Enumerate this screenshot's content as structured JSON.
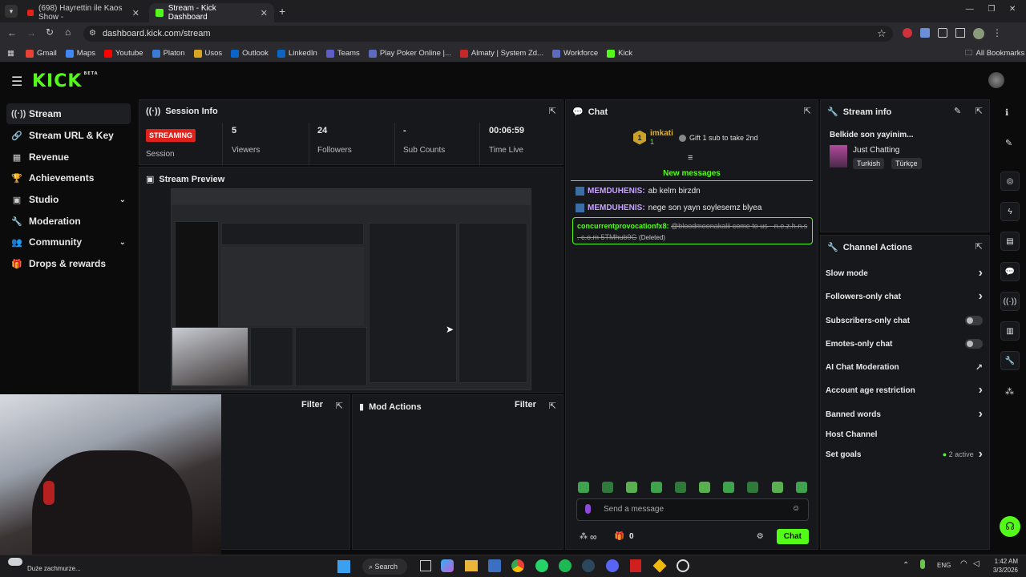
{
  "browser": {
    "tabs": [
      {
        "title": "(698) Hayrettin ile Kaos Show -",
        "close": "✕"
      },
      {
        "title": "Stream - Kick Dashboard",
        "close": "✕"
      }
    ],
    "new_tab": "+",
    "url": "dashboard.kick.com/stream",
    "bookmarks": [
      "Gmail",
      "Maps",
      "Youtube",
      "Platon",
      "Usos",
      "Outlook",
      "LinkedIn",
      "Teams",
      "Play Poker Online |...",
      "Almaty | System Zd...",
      "Workforce",
      "Kick"
    ],
    "all_bookmarks": "All Bookmarks"
  },
  "app": {
    "logo": "KICK",
    "logo_badge": "BETA"
  },
  "sidebar": {
    "items": [
      {
        "label": "Stream",
        "icon": "broadcast-icon",
        "glyph": "((·))"
      },
      {
        "label": "Stream URL & Key",
        "icon": "link-icon",
        "glyph": "🔗"
      },
      {
        "label": "Revenue",
        "icon": "revenue-icon",
        "glyph": "▦"
      },
      {
        "label": "Achievements",
        "icon": "trophy-icon",
        "glyph": "🏆"
      },
      {
        "label": "Studio",
        "icon": "studio-icon",
        "glyph": "▣"
      },
      {
        "label": "Moderation",
        "icon": "wrench-icon",
        "glyph": "🔧"
      },
      {
        "label": "Community",
        "icon": "users-icon",
        "glyph": "👥"
      },
      {
        "label": "Drops & rewards",
        "icon": "gift-icon",
        "glyph": "🎁"
      }
    ]
  },
  "session": {
    "title": "Session Info",
    "status_badge": "STREAMING",
    "stats": [
      {
        "value": "",
        "label": "Session"
      },
      {
        "value": "5",
        "label": "Viewers"
      },
      {
        "value": "24",
        "label": "Followers"
      },
      {
        "value": "-",
        "label": "Sub Counts"
      },
      {
        "value": "00:06:59",
        "label": "Time Live"
      }
    ]
  },
  "preview": {
    "title": "Stream Preview"
  },
  "panels": {
    "filter_label": "Filter",
    "mod_actions_title": "Mod Actions"
  },
  "chat": {
    "title": "Chat",
    "top_user": "imkati",
    "top_user_count": "1",
    "gift_text": "Gift 1 sub to take 2nd",
    "new_messages": "New messages",
    "messages": [
      {
        "user": "MEMDUHENIS:",
        "text": "ab kelm birzdn",
        "color": "#c8a3ff"
      },
      {
        "user": "MEMDUHENIS:",
        "text": "nege son yayn soylesemz blyea",
        "color": "#c8a3ff"
      }
    ],
    "deleted_msg": {
      "user": "concurrentprovocationfx8:",
      "text": "@bloodmoonakalii come to us - n.e.z.h.n.s . c.o.m 5TMhub9G",
      "deleted_tag": "(Deleted)"
    },
    "input_placeholder": "Send a message",
    "infinity": "∞",
    "gift_count": "0",
    "send_button": "Chat"
  },
  "stream_info": {
    "title": "Stream info",
    "stream_title": "Belkide son yayinim...",
    "category": "Just Chatting",
    "tags": [
      "Turkish",
      "Türkçe"
    ]
  },
  "channel_actions": {
    "title": "Channel Actions",
    "items": [
      {
        "label": "Slow mode",
        "control": "chevron"
      },
      {
        "label": "Followers-only chat",
        "control": "chevron"
      },
      {
        "label": "Subscribers-only chat",
        "control": "toggle"
      },
      {
        "label": "Emotes-only chat",
        "control": "toggle"
      },
      {
        "label": "AI Chat Moderation",
        "control": "external"
      },
      {
        "label": "Account age restriction",
        "control": "chevron"
      },
      {
        "label": "Banned words",
        "control": "chevron"
      },
      {
        "label": "Host Channel",
        "control": "none"
      },
      {
        "label": "Set goals",
        "control": "chevron",
        "extra": "2 active"
      }
    ]
  },
  "taskbar": {
    "search": "Search",
    "language": "ENG",
    "time": "1:42 AM",
    "date": "3/3/2026",
    "weather": "Duże zachmurze..."
  },
  "colors": {
    "accent": "#53fc18",
    "streaming_badge": "#e0221c",
    "panel": "#17181b",
    "bg": "#0b0b0c"
  }
}
